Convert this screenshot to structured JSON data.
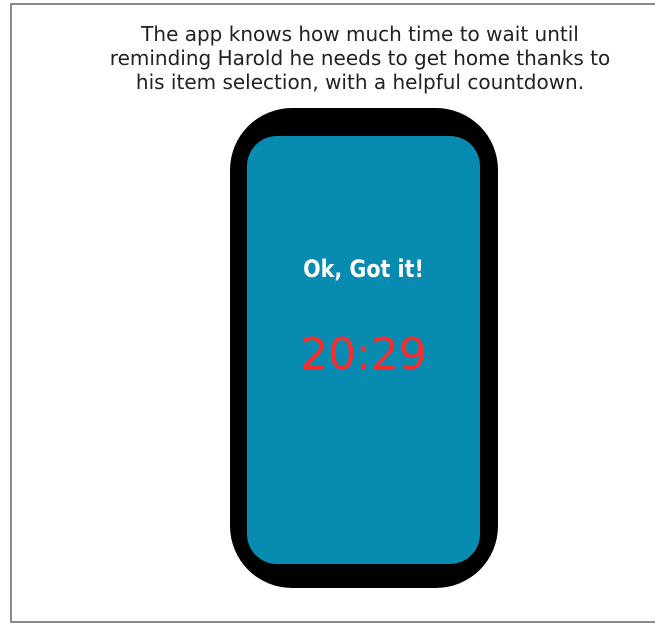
{
  "caption": {
    "line1": "The app knows how much time to wait until",
    "line2": "reminding Harold he needs to get home thanks to",
    "line3": "his item selection, with a helpful countdown."
  },
  "phone": {
    "heading": "Ok, Got it!",
    "countdown": "20:29",
    "colors": {
      "screen": "#078bb1",
      "bezel": "#000000",
      "heading": "#ffffff",
      "countdown": "#ff2a2a"
    }
  }
}
